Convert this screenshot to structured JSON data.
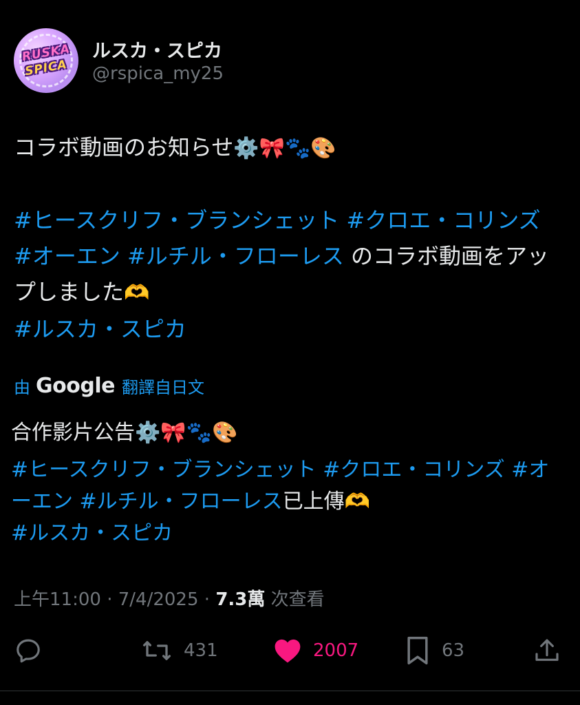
{
  "author": {
    "avatar_text_line1": "RUSKA",
    "avatar_text_line2": "SPICA",
    "display_name": "ルスカ・スピカ",
    "handle": "@rspica_my25"
  },
  "post": {
    "line1_text": "コラボ動画のお知らせ",
    "line1_emojis": "⚙️🎀🐾🎨",
    "tag1": "#ヒースクリフ・ブランシェット",
    "tag2": "#クロエ・コリンズ",
    "tag3": "#オーエン",
    "tag4": "#ルチル・フローレス",
    "text_after_tags": " のコラボ動画をアップしました",
    "heart_hands": "🫶",
    "tag5": "#ルスカ・スピカ"
  },
  "translation": {
    "prefix": "由",
    "brand": "Google",
    "suffix": "翻譯自日文",
    "line1_text": "合作影片公告",
    "line1_emojis": "⚙️🎀🐾🎨",
    "tag1": "#ヒースクリフ・ブランシェット",
    "tag2": "#クロエ・コリンズ",
    "tag3": "#オーエン",
    "tag4": "#ルチル・フローレス",
    "text_after_tags": "已上傳",
    "heart_hands": "🫶",
    "tag5": "#ルスカ・スピカ"
  },
  "meta": {
    "time": "上午11:00",
    "separator": " · ",
    "date": "7/4/2025",
    "views_count": "7.3萬",
    "views_label": " 次查看"
  },
  "actions": {
    "reply_icon": "reply-icon",
    "retweet_count": "431",
    "like_count": "2007",
    "bookmark_count": "63",
    "share_icon": "share-icon"
  },
  "colors": {
    "background": "#000000",
    "text": "#e7e9ea",
    "secondary": "#71767b",
    "link": "#1d9bf0",
    "like": "#f91880"
  }
}
